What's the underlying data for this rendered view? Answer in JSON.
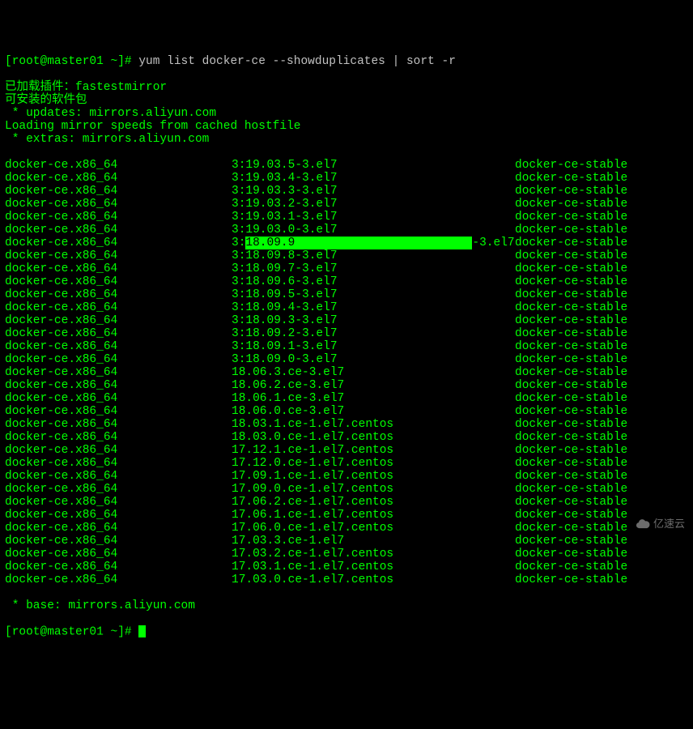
{
  "prompt1": {
    "prefix": "[root@master01 ~]# ",
    "command": "yum list docker-ce --showduplicates | sort -r"
  },
  "header_lines": [
    "已加载插件：fastestmirror",
    "可安装的软件包",
    " * updates: mirrors.aliyun.com",
    "Loading mirror speeds from cached hostfile",
    " * extras: mirrors.aliyun.com"
  ],
  "highlight_value": "18.09.9",
  "rows": [
    {
      "name": "docker-ce.x86_64",
      "version": "3:19.03.5-3.el7",
      "repo": "docker-ce-stable"
    },
    {
      "name": "docker-ce.x86_64",
      "version": "3:19.03.4-3.el7",
      "repo": "docker-ce-stable"
    },
    {
      "name": "docker-ce.x86_64",
      "version": "3:19.03.3-3.el7",
      "repo": "docker-ce-stable"
    },
    {
      "name": "docker-ce.x86_64",
      "version": "3:19.03.2-3.el7",
      "repo": "docker-ce-stable"
    },
    {
      "name": "docker-ce.x86_64",
      "version": "3:19.03.1-3.el7",
      "repo": "docker-ce-stable"
    },
    {
      "name": "docker-ce.x86_64",
      "version": "3:19.03.0-3.el7",
      "repo": "docker-ce-stable"
    },
    {
      "name": "docker-ce.x86_64",
      "version": "3:18.09.9-3.el7",
      "repo": "docker-ce-stable",
      "hl": true
    },
    {
      "name": "docker-ce.x86_64",
      "version": "3:18.09.8-3.el7",
      "repo": "docker-ce-stable"
    },
    {
      "name": "docker-ce.x86_64",
      "version": "3:18.09.7-3.el7",
      "repo": "docker-ce-stable"
    },
    {
      "name": "docker-ce.x86_64",
      "version": "3:18.09.6-3.el7",
      "repo": "docker-ce-stable"
    },
    {
      "name": "docker-ce.x86_64",
      "version": "3:18.09.5-3.el7",
      "repo": "docker-ce-stable"
    },
    {
      "name": "docker-ce.x86_64",
      "version": "3:18.09.4-3.el7",
      "repo": "docker-ce-stable"
    },
    {
      "name": "docker-ce.x86_64",
      "version": "3:18.09.3-3.el7",
      "repo": "docker-ce-stable"
    },
    {
      "name": "docker-ce.x86_64",
      "version": "3:18.09.2-3.el7",
      "repo": "docker-ce-stable"
    },
    {
      "name": "docker-ce.x86_64",
      "version": "3:18.09.1-3.el7",
      "repo": "docker-ce-stable"
    },
    {
      "name": "docker-ce.x86_64",
      "version": "3:18.09.0-3.el7",
      "repo": "docker-ce-stable"
    },
    {
      "name": "docker-ce.x86_64",
      "version": "18.06.3.ce-3.el7",
      "repo": "docker-ce-stable"
    },
    {
      "name": "docker-ce.x86_64",
      "version": "18.06.2.ce-3.el7",
      "repo": "docker-ce-stable"
    },
    {
      "name": "docker-ce.x86_64",
      "version": "18.06.1.ce-3.el7",
      "repo": "docker-ce-stable"
    },
    {
      "name": "docker-ce.x86_64",
      "version": "18.06.0.ce-3.el7",
      "repo": "docker-ce-stable"
    },
    {
      "name": "docker-ce.x86_64",
      "version": "18.03.1.ce-1.el7.centos",
      "repo": "docker-ce-stable"
    },
    {
      "name": "docker-ce.x86_64",
      "version": "18.03.0.ce-1.el7.centos",
      "repo": "docker-ce-stable"
    },
    {
      "name": "docker-ce.x86_64",
      "version": "17.12.1.ce-1.el7.centos",
      "repo": "docker-ce-stable"
    },
    {
      "name": "docker-ce.x86_64",
      "version": "17.12.0.ce-1.el7.centos",
      "repo": "docker-ce-stable"
    },
    {
      "name": "docker-ce.x86_64",
      "version": "17.09.1.ce-1.el7.centos",
      "repo": "docker-ce-stable"
    },
    {
      "name": "docker-ce.x86_64",
      "version": "17.09.0.ce-1.el7.centos",
      "repo": "docker-ce-stable"
    },
    {
      "name": "docker-ce.x86_64",
      "version": "17.06.2.ce-1.el7.centos",
      "repo": "docker-ce-stable"
    },
    {
      "name": "docker-ce.x86_64",
      "version": "17.06.1.ce-1.el7.centos",
      "repo": "docker-ce-stable"
    },
    {
      "name": "docker-ce.x86_64",
      "version": "17.06.0.ce-1.el7.centos",
      "repo": "docker-ce-stable"
    },
    {
      "name": "docker-ce.x86_64",
      "version": "17.03.3.ce-1.el7",
      "repo": "docker-ce-stable"
    },
    {
      "name": "docker-ce.x86_64",
      "version": "17.03.2.ce-1.el7.centos",
      "repo": "docker-ce-stable"
    },
    {
      "name": "docker-ce.x86_64",
      "version": "17.03.1.ce-1.el7.centos",
      "repo": "docker-ce-stable"
    },
    {
      "name": "docker-ce.x86_64",
      "version": "17.03.0.ce-1.el7.centos",
      "repo": "docker-ce-stable"
    }
  ],
  "footer_line": " * base: mirrors.aliyun.com",
  "prompt2": {
    "prefix": "[root@master01 ~]# "
  },
  "watermark_text": "亿速云"
}
